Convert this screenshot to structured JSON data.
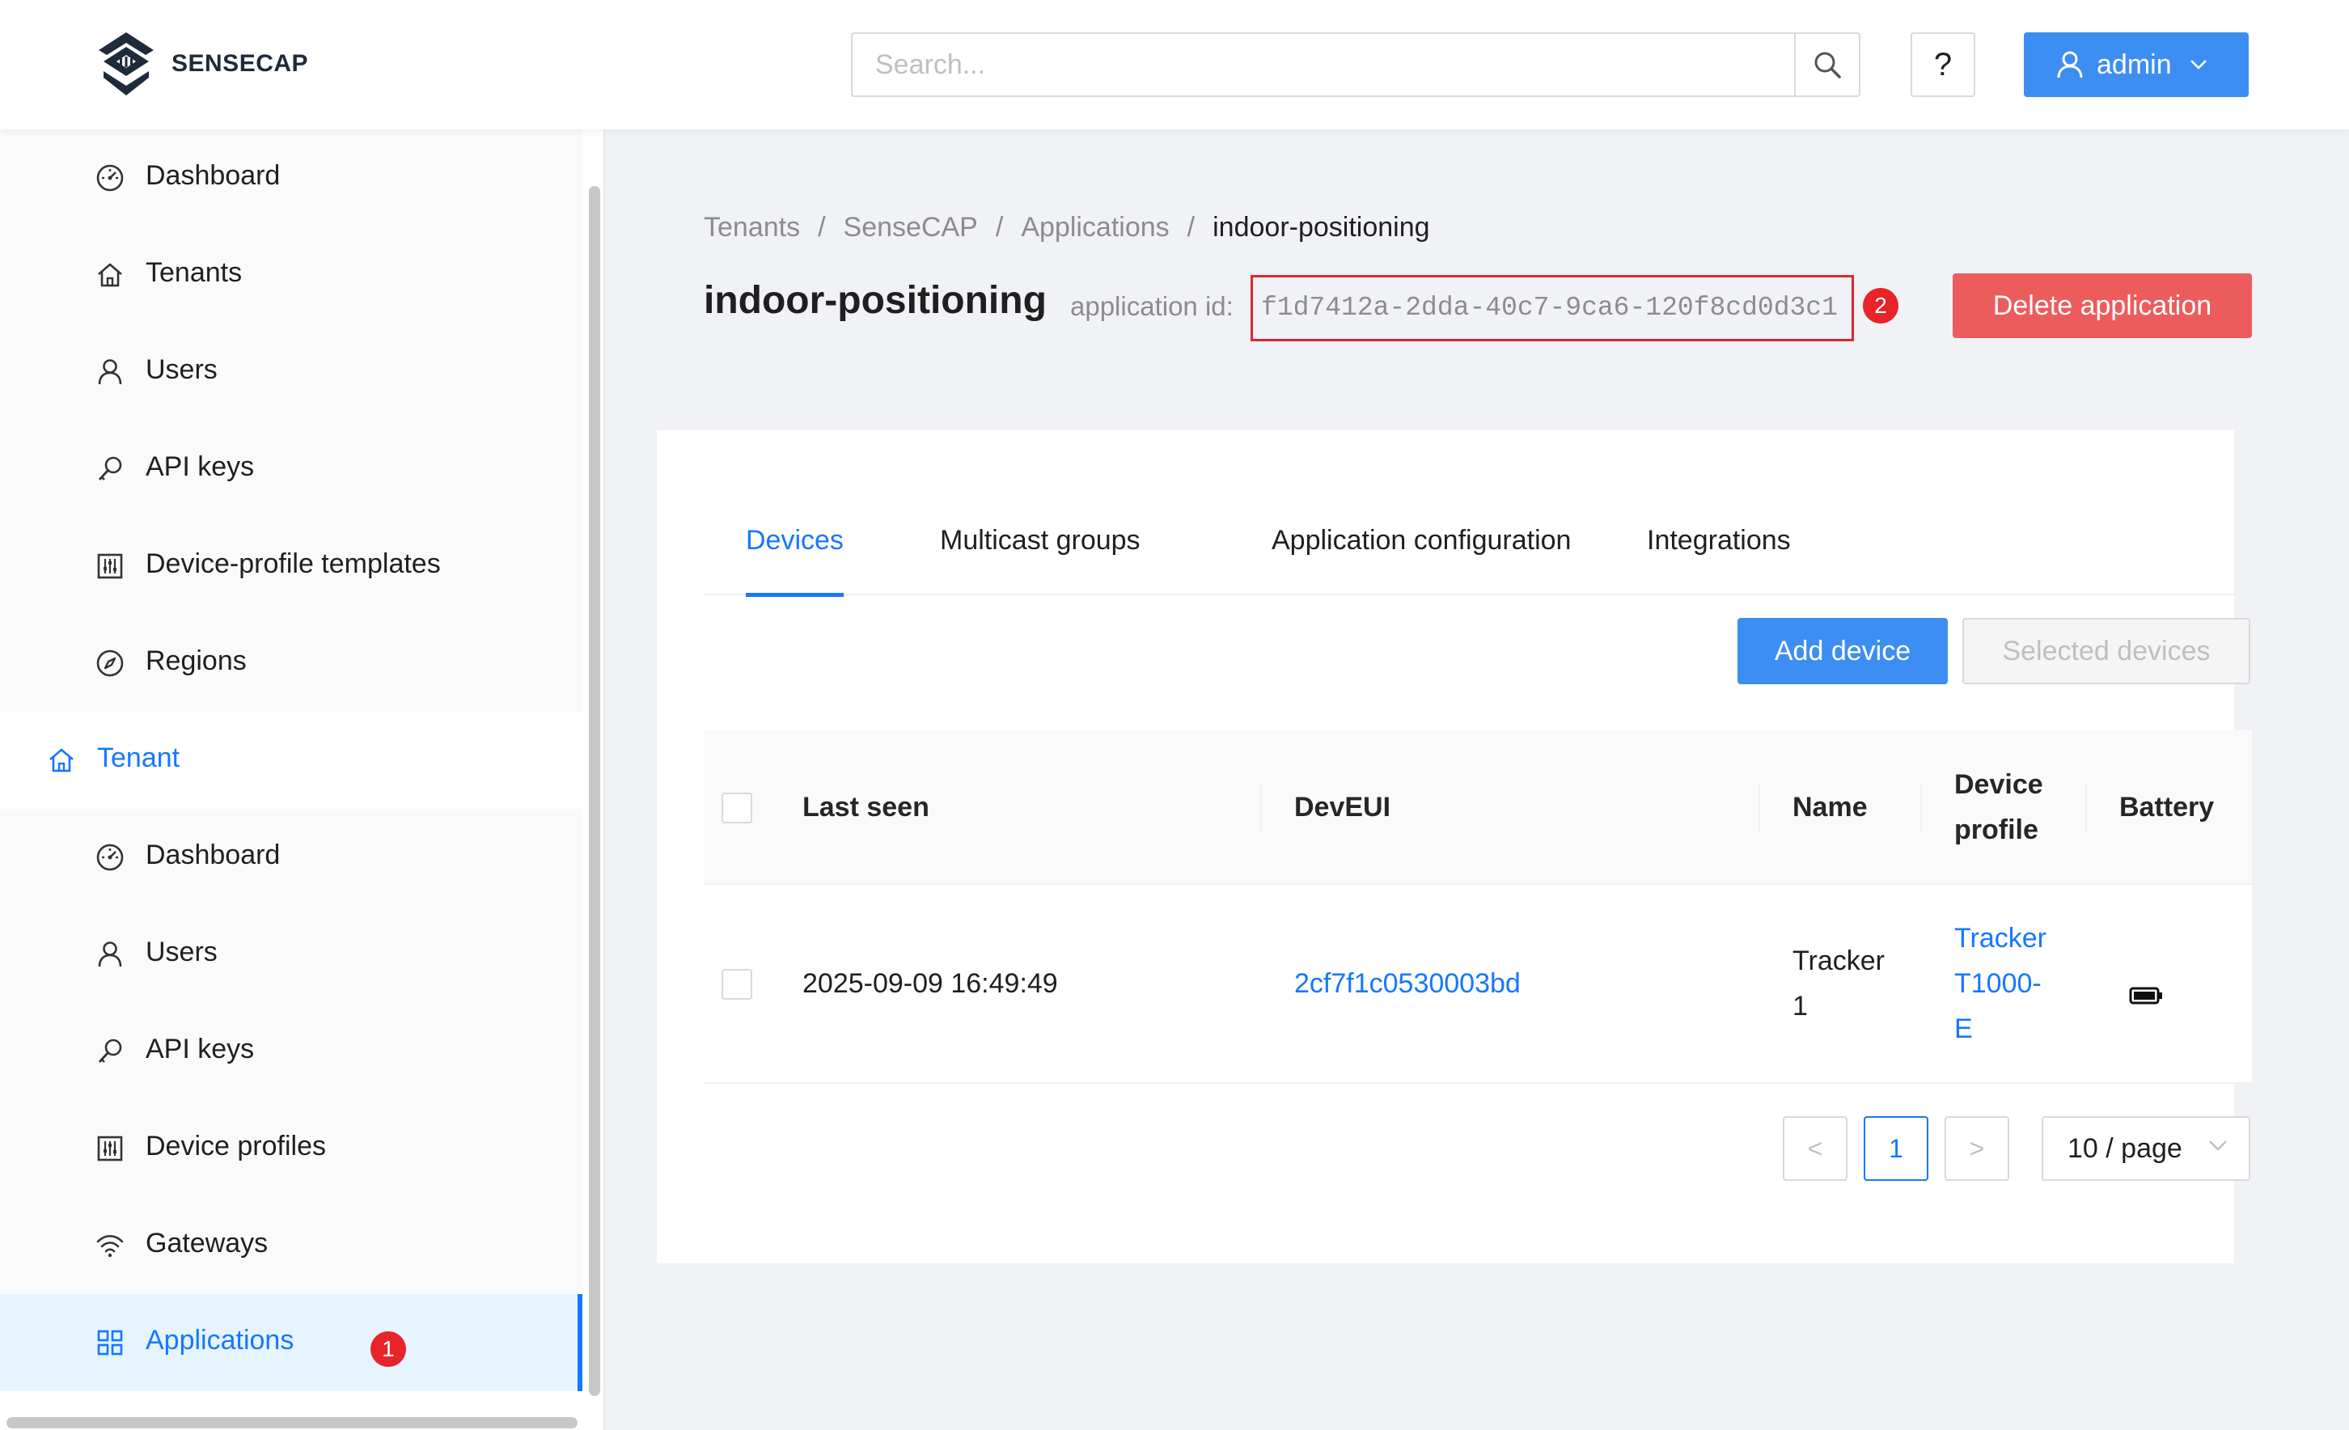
{
  "header": {
    "brand": "SENSECAP",
    "search_placeholder": "Search...",
    "help_label": "?",
    "user_name": "admin"
  },
  "sidebar": {
    "admin_items": [
      {
        "label": "Dashboard",
        "icon": "dashboard-icon"
      },
      {
        "label": "Tenants",
        "icon": "home-icon"
      },
      {
        "label": "Users",
        "icon": "user-icon"
      },
      {
        "label": "API keys",
        "icon": "key-icon"
      },
      {
        "label": "Device-profile templates",
        "icon": "sliders-icon"
      },
      {
        "label": "Regions",
        "icon": "compass-icon"
      }
    ],
    "tenant_group": {
      "label": "Tenant",
      "icon": "home-icon"
    },
    "tenant_items": [
      {
        "label": "Dashboard",
        "icon": "dashboard-icon"
      },
      {
        "label": "Users",
        "icon": "user-icon"
      },
      {
        "label": "API keys",
        "icon": "key-icon"
      },
      {
        "label": "Device profiles",
        "icon": "sliders-icon"
      },
      {
        "label": "Gateways",
        "icon": "wifi-icon"
      },
      {
        "label": "Applications",
        "icon": "grid-icon",
        "active": true
      }
    ],
    "annotation_badge": "1"
  },
  "breadcrumb": [
    "Tenants",
    "SenseCAP",
    "Applications",
    "indoor-positioning"
  ],
  "breadcrumb_separator": "/",
  "page": {
    "title": "indoor-positioning",
    "app_id_label": "application id:",
    "app_id_value": "f1d7412a-2dda-40c7-9ca6-120f8cd0d3c1",
    "annotation_badge": "2",
    "delete_label": "Delete application"
  },
  "tabs": [
    {
      "label": "Devices",
      "active": true
    },
    {
      "label": "Multicast groups"
    },
    {
      "label": "Application configuration"
    },
    {
      "label": "Integrations"
    }
  ],
  "actions": {
    "add_device": "Add device",
    "selected_devices": "Selected devices"
  },
  "table": {
    "columns": {
      "last_seen": "Last seen",
      "deveui": "DevEUI",
      "name": "Name",
      "device_profile_line1": "Device",
      "device_profile_line2": "profile",
      "battery": "Battery"
    },
    "rows": [
      {
        "last_seen": "2025-09-09 16:49:49",
        "deveui": "2cf7f1c0530003bd",
        "name_line1": "Tracker",
        "name_line2": "1",
        "profile_line1": "Tracker",
        "profile_line2": "T1000-",
        "profile_line3": "E",
        "battery_icon": "battery-full-icon"
      }
    ]
  },
  "pagination": {
    "prev": "<",
    "current_page": "1",
    "next": ">",
    "page_size": "10 / page"
  },
  "colors": {
    "primary": "#1677ff",
    "button_blue": "#3d8ef2",
    "danger": "#ed5c5c",
    "annotation_red": "#e8232a"
  }
}
